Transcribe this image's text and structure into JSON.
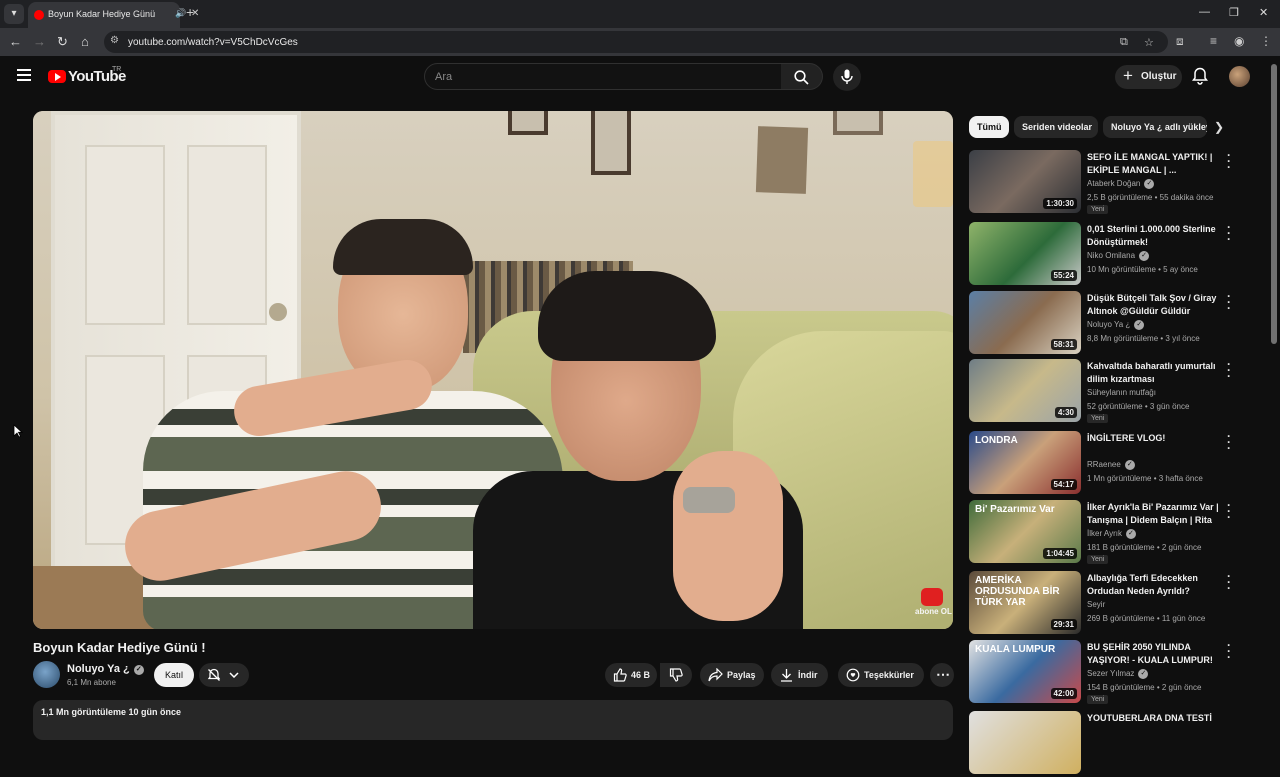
{
  "browser": {
    "tab_title": "Boyun Kadar Hediye Günü !",
    "url": "youtube.com/watch?v=V5ChDcVcGes"
  },
  "header": {
    "logo_text": "YouTube",
    "region": "TR",
    "search_placeholder": "Ara",
    "create_label": "Oluştur"
  },
  "video": {
    "title": "Boyun Kadar Hediye Günü !",
    "watermark": "abone OL",
    "channel": {
      "name": "Noluyo Ya ¿",
      "subscribers": "6,1 Mn abone",
      "join_label": "Katıl"
    },
    "actions": {
      "likes": "46 B",
      "share": "Paylaş",
      "download": "İndir",
      "thanks": "Teşekkürler"
    },
    "description_meta": "1,1 Mn görüntüleme  10 gün önce"
  },
  "sidebar": {
    "chips": [
      "Tümü",
      "Seriden videolar",
      "Noluyo Ya ¿ adlı yükleyiciden"
    ],
    "recommendations": [
      {
        "title": "SEFO İLE MANGAL YAPTIK! | EKİPLE MANGAL | ...",
        "channel": "Ataberk Doğan",
        "verified": true,
        "stats": "2,5 B görüntüleme • 55 dakika önce",
        "badge": "Yeni",
        "duration": "1:30:30",
        "thumb_text": ""
      },
      {
        "title": "0,01 Sterlini 1.000.000 Sterline Dönüştürmek!",
        "channel": "Niko Omilana",
        "verified": true,
        "stats": "10 Mn görüntüleme • 5 ay önce",
        "badge": "",
        "duration": "55:24",
        "thumb_text": ""
      },
      {
        "title": "Düşük Bütçeli Talk Şov / Giray Altınok @Güldür Güldür",
        "channel": "Noluyo Ya ¿",
        "verified": true,
        "stats": "8,8 Mn görüntüleme • 3 yıl önce",
        "badge": "",
        "duration": "58:31",
        "thumb_text": ""
      },
      {
        "title": "Kahvaltıda baharatlı yumurtalı dilim kızartması",
        "channel": "Süheylanın mutfağı",
        "verified": false,
        "stats": "52 görüntüleme • 3 gün önce",
        "badge": "Yeni",
        "duration": "4:30",
        "thumb_text": ""
      },
      {
        "title": "İNGİLTERE VLOG!",
        "channel": "RRaenee",
        "verified": true,
        "stats": "1 Mn görüntüleme • 3 hafta önce",
        "badge": "",
        "duration": "54:17",
        "thumb_text": "LONDRA"
      },
      {
        "title": "İlker Ayrık'la Bi' Pazarımız Var | Tanışma | Didem Balçın | Rita ...",
        "channel": "İlker Ayrık",
        "verified": true,
        "stats": "181 B görüntüleme • 2 gün önce",
        "badge": "Yeni",
        "duration": "1:04:45",
        "thumb_text": "Bi' Pazarımız Var"
      },
      {
        "title": "Albaylığa Terfi Edecekken Ordudan Neden Ayrıldı?",
        "channel": "Seyir",
        "verified": false,
        "stats": "269 B görüntüleme • 11 gün önce",
        "badge": "",
        "duration": "29:31",
        "thumb_text": "AMERİKA ORDUSUNDA BİR TÜRK YAR"
      },
      {
        "title": "BU ŞEHİR 2050 YILINDA YAŞIYOR! - KUALA LUMPUR!",
        "channel": "Sezer Yılmaz",
        "verified": true,
        "stats": "154 B görüntüleme • 2 gün önce",
        "badge": "Yeni",
        "duration": "42:00",
        "thumb_text": "KUALA LUMPUR"
      },
      {
        "title": "YOUTUBERLARA DNA TESTİ",
        "channel": "",
        "verified": false,
        "stats": "",
        "badge": "",
        "duration": "",
        "thumb_text": ""
      }
    ]
  },
  "colors": {
    "background": "#0f0f0f",
    "brand_red": "#ff0000",
    "chip_active": "#f1f1f1",
    "surface": "#272727"
  }
}
